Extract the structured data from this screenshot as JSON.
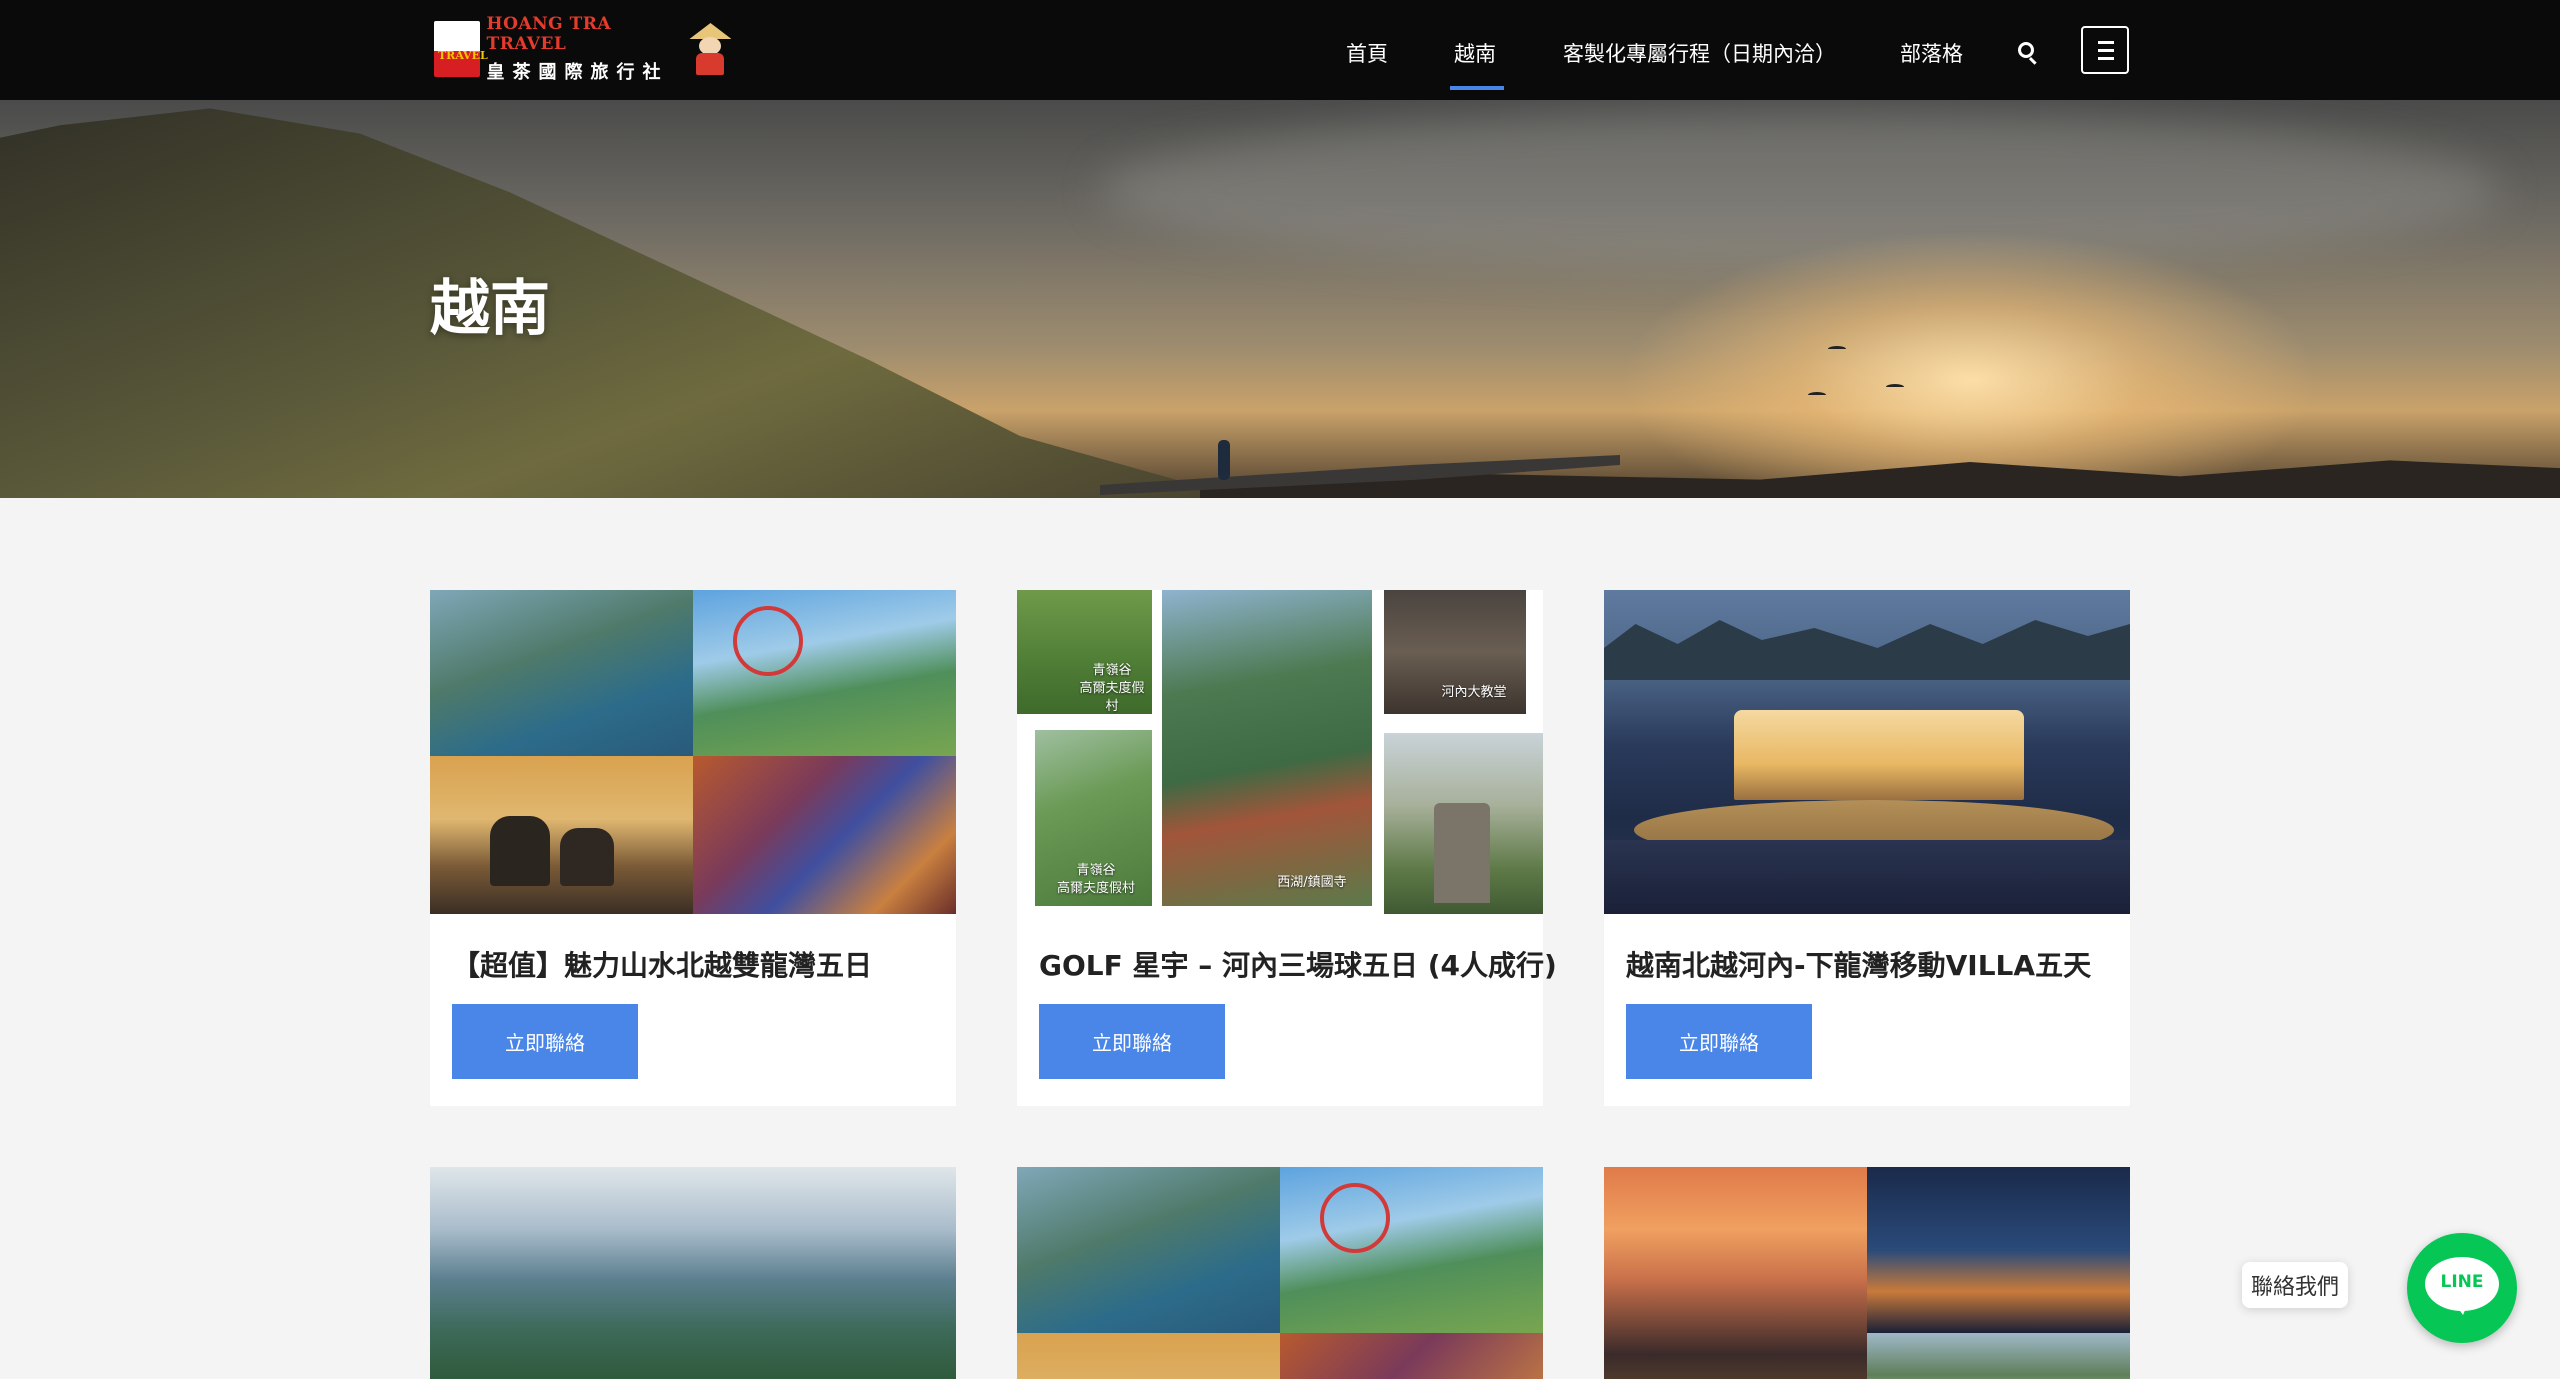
{
  "header": {
    "logo": {
      "en": "HOANG TRA TRAVEL",
      "zh": "皇茶國際旅行社",
      "flag_text": "TRAVEL"
    },
    "nav": [
      {
        "label": "首頁"
      },
      {
        "label": "越南",
        "active": true
      },
      {
        "label": "客製化專屬行程（日期內洽）"
      },
      {
        "label": "部落格"
      }
    ],
    "icons": [
      "search-icon",
      "menu-icon"
    ]
  },
  "hero": {
    "title": "越南"
  },
  "cards": [
    {
      "title": "【超值】魅力山水北越雙龍灣五日",
      "button": "立即聯絡"
    },
    {
      "title": "GOLF 星宇 – 河內三場球五日 (4人成行)",
      "button": "立即聯絡",
      "image_labels": [
        "青嶺谷\n高爾夫度假村",
        "河內大教堂",
        "青嶺谷\n高爾夫度假村",
        "西湖/鎮國寺"
      ]
    },
    {
      "title": "越南北越河內-下龍灣移動VILLA五天",
      "button": "立即聯絡"
    }
  ],
  "contact": {
    "label": "聯絡我們",
    "line_label": "LINE"
  },
  "colors": {
    "accent": "#4a86e8",
    "header_bg": "#0a0a0a",
    "line_green": "#06c755"
  }
}
